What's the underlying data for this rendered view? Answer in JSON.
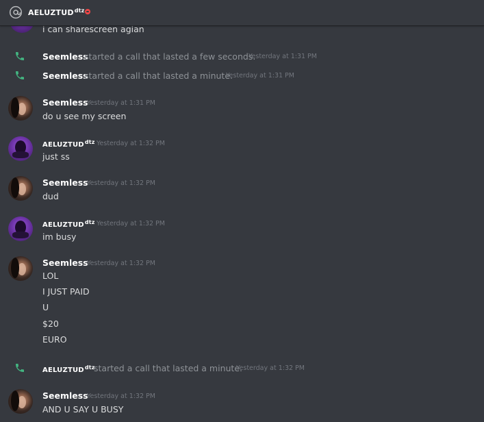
{
  "header": {
    "name": "AELUZTUD",
    "name_sup": "dtz",
    "status": "do-not-disturb",
    "status_color": "#f04747",
    "icon": "at-icon"
  },
  "messages": [
    {
      "type": "text",
      "text": "i can sharescreen agian"
    },
    {
      "type": "call",
      "author": "Seemless",
      "text": "started a call that lasted a few seconds.",
      "timestamp": "Yesterday at 1:31 PM"
    },
    {
      "type": "call",
      "author": "Seemless",
      "text": "started a call that lasted a minute.",
      "timestamp": "Yesterday at 1:31 PM"
    },
    {
      "type": "group",
      "author": "Seemless",
      "timestamp": "Yesterday at 1:31 PM",
      "lines": [
        "do u see my screen"
      ]
    },
    {
      "type": "group",
      "author": "AELUZTUD",
      "author_sup": "dtz",
      "timestamp": "Yesterday at 1:32 PM",
      "lines": [
        "just ss"
      ]
    },
    {
      "type": "group",
      "author": "Seemless",
      "timestamp": "Yesterday at 1:32 PM",
      "lines": [
        "dud"
      ]
    },
    {
      "type": "group",
      "author": "AELUZTUD",
      "author_sup": "dtz",
      "timestamp": "Yesterday at 1:32 PM",
      "lines": [
        "im busy"
      ]
    },
    {
      "type": "group",
      "author": "Seemless",
      "timestamp": "Yesterday at 1:32 PM",
      "lines": [
        "LOL",
        "I JUST PAID",
        "U",
        "$20",
        "EURO"
      ]
    },
    {
      "type": "call",
      "author": "AELUZTUD",
      "author_sup": "dtz",
      "text": "started a call that lasted a minute.",
      "timestamp": "Yesterday at 1:32 PM"
    },
    {
      "type": "group",
      "author": "Seemless",
      "timestamp": "Yesterday at 1:32 PM",
      "lines": [
        "AND U SAY U BUSY"
      ]
    }
  ],
  "colors": {
    "background": "#36393f",
    "text": "#dcddde",
    "timestamp": "#72767d",
    "call_icon": "#43b581",
    "system_text": "#8e9297"
  }
}
